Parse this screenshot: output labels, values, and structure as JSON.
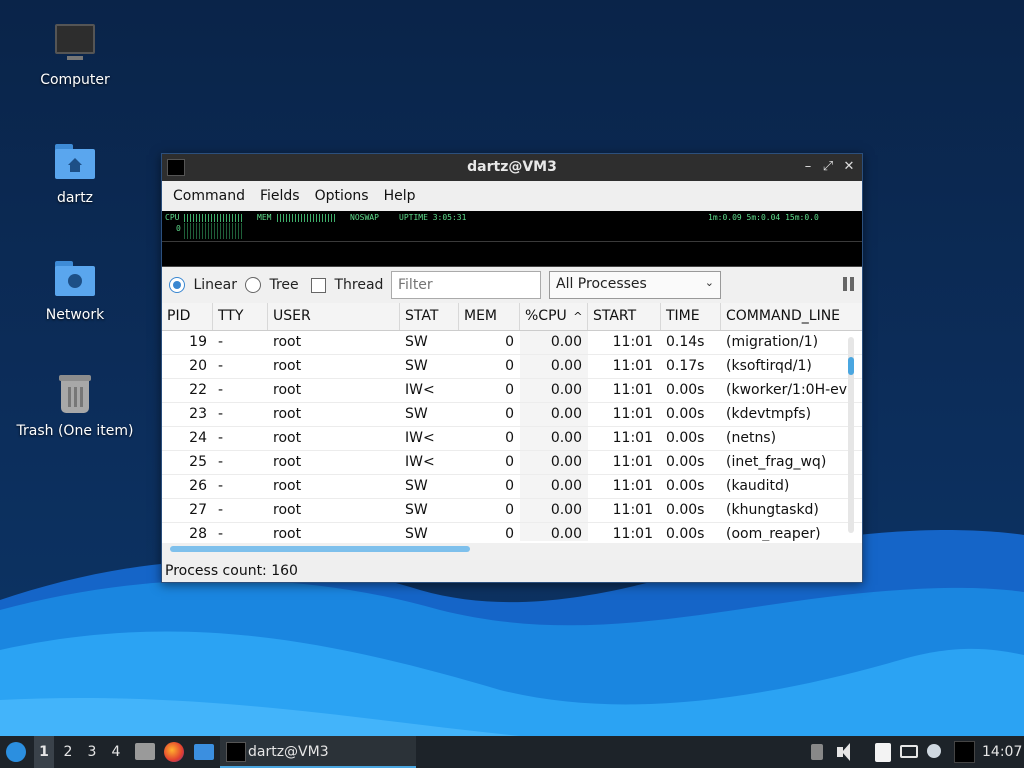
{
  "desktop": {
    "icons": [
      {
        "label": "Computer",
        "icon": "monitor-icon"
      },
      {
        "label": "dartz",
        "icon": "home-folder-icon"
      },
      {
        "label": "Network",
        "icon": "network-folder-icon"
      },
      {
        "label": "Trash (One item)",
        "icon": "trash-icon"
      }
    ]
  },
  "window": {
    "title": "dartz@VM3",
    "controls": {
      "minimize": "–",
      "maximize": "⤢",
      "close": "✕"
    },
    "menu": [
      "Command",
      "Fields",
      "Options",
      "Help"
    ],
    "graph": {
      "cpu_label": "CPU",
      "mem_label": "MEM",
      "swap_label": "NOSWAP",
      "uptime_label": "UPTIME 3:05:31",
      "load_label": "1m:0.09 5m:0.04 15m:0.0",
      "cpu_index": "0"
    },
    "filter": {
      "linear_label": "Linear",
      "tree_label": "Tree",
      "thread_label": "Thread",
      "linear_selected": true,
      "tree_selected": false,
      "thread_checked": false,
      "filter_placeholder": "Filter",
      "process_scope": "All Processes"
    },
    "table": {
      "columns": [
        "PID",
        "TTY",
        "USER",
        "STAT",
        "MEM",
        "%CPU",
        "START",
        "TIME",
        "COMMAND_LINE"
      ],
      "sort_column": "%CPU",
      "sort_indicator": "^",
      "rows": [
        [
          "19",
          "-",
          "root",
          "SW",
          "0",
          "0.00",
          "11:01",
          "0.14s",
          "(migration/1)"
        ],
        [
          "20",
          "-",
          "root",
          "SW",
          "0",
          "0.00",
          "11:01",
          "0.17s",
          "(ksoftirqd/1)"
        ],
        [
          "22",
          "-",
          "root",
          "IW<",
          "0",
          "0.00",
          "11:01",
          "0.00s",
          "(kworker/1:0H-ev"
        ],
        [
          "23",
          "-",
          "root",
          "SW",
          "0",
          "0.00",
          "11:01",
          "0.00s",
          "(kdevtmpfs)"
        ],
        [
          "24",
          "-",
          "root",
          "IW<",
          "0",
          "0.00",
          "11:01",
          "0.00s",
          "(netns)"
        ],
        [
          "25",
          "-",
          "root",
          "IW<",
          "0",
          "0.00",
          "11:01",
          "0.00s",
          "(inet_frag_wq)"
        ],
        [
          "26",
          "-",
          "root",
          "SW",
          "0",
          "0.00",
          "11:01",
          "0.00s",
          "(kauditd)"
        ],
        [
          "27",
          "-",
          "root",
          "SW",
          "0",
          "0.00",
          "11:01",
          "0.00s",
          "(khungtaskd)"
        ],
        [
          "28",
          "-",
          "root",
          "SW",
          "0",
          "0.00",
          "11:01",
          "0.00s",
          "(oom_reaper)"
        ]
      ]
    },
    "status": "Process count: 160"
  },
  "taskbar": {
    "workspaces": [
      "1",
      "2",
      "3",
      "4"
    ],
    "active_workspace": "1",
    "task_title": "dartz@VM3",
    "clock": "14:07"
  }
}
